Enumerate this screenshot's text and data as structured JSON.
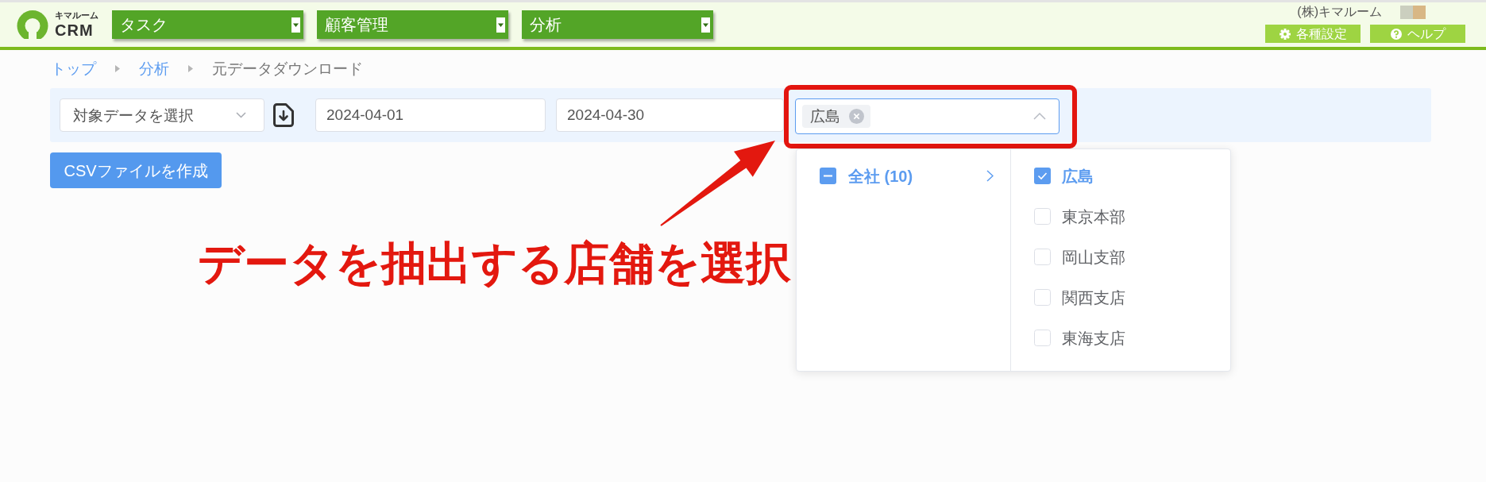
{
  "header": {
    "logo": {
      "caption": "キマルーム",
      "name": "CRM"
    },
    "nav_menus": [
      {
        "label": "タスク"
      },
      {
        "label": "顧客管理"
      },
      {
        "label": "分析"
      }
    ],
    "company": "(株)キマルーム",
    "buttons": [
      {
        "kind": "settings",
        "label": "各種設定"
      },
      {
        "kind": "help",
        "label": "ヘルプ"
      }
    ]
  },
  "breadcrumb": [
    {
      "label": "トップ",
      "link": true
    },
    {
      "label": "分析",
      "link": true
    },
    {
      "label": "元データダウンロード",
      "link": false
    }
  ],
  "filters": {
    "data_select": {
      "text": "対象データを選択"
    },
    "start_date": {
      "value": "2024-04-01"
    },
    "end_date": {
      "value": "2024-04-30"
    },
    "store_select": {
      "expanded": true,
      "tags": [
        {
          "label": "広島"
        }
      ]
    }
  },
  "csv_button": {
    "label": "CSVファイルを作成"
  },
  "store_dropdown": {
    "groups": [
      {
        "label": "全社 (10)",
        "indeterminate": true,
        "selected": true
      }
    ],
    "stores": [
      {
        "label": "広島",
        "checked": true
      },
      {
        "label": "東京本部",
        "checked": false
      },
      {
        "label": "岡山支部",
        "checked": false
      },
      {
        "label": "関西支店",
        "checked": false
      },
      {
        "label": "東海支店",
        "checked": false
      }
    ]
  },
  "annotation": {
    "text": "データを抽出する店舗を選択"
  }
}
